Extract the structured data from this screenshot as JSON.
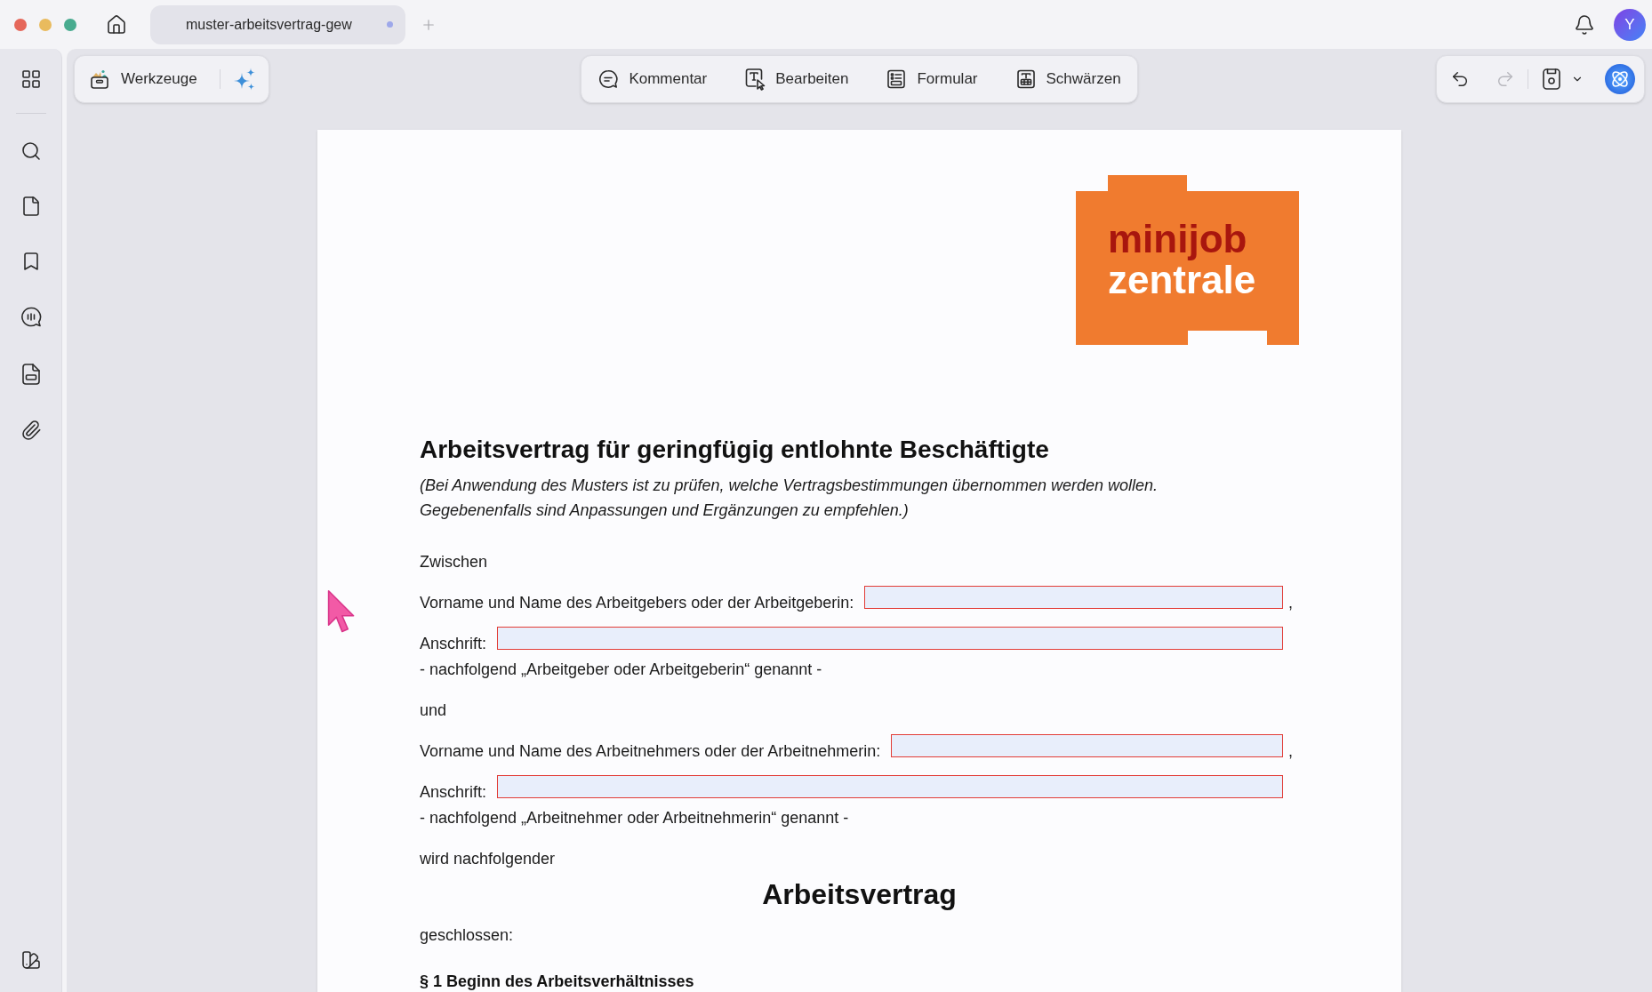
{
  "tabs": [
    {
      "label": "muster-arbeitsvertrag-gew",
      "selected": true
    }
  ],
  "user": {
    "initial": "Y"
  },
  "toolbar": {
    "tools_button": {
      "label": "Werkzeuge"
    },
    "modes": [
      {
        "kind": "comment",
        "label": "Kommentar"
      },
      {
        "kind": "edit",
        "label": "Bearbeiten"
      },
      {
        "kind": "form",
        "label": "Formular"
      },
      {
        "kind": "redact",
        "label": "Schwärzen"
      }
    ],
    "history": [
      {
        "kind": "undo",
        "disabled": false
      },
      {
        "kind": "redo",
        "disabled": true
      }
    ]
  },
  "document": {
    "logo": {
      "lines": [
        "minijob",
        "zentrale"
      ]
    },
    "title": "Arbeitsvertrag für geringfügig entlohnte Beschäftigte",
    "subtitle": "(Bei Anwendung des Musters ist zu prüfen, welche Vertragsbestimmungen übernommen werden wollen. Gegebenenfalls sind Anpassungen und Ergänzungen zu empfehlen.)",
    "blocks": [
      {
        "kind": "paragraph",
        "text": "Zwischen"
      },
      {
        "kind": "field_row",
        "label": "Vorname und Name des Arbeitgebers oder der Arbeitgeberin:",
        "suffix": ","
      },
      {
        "kind": "field_row",
        "label": "Anschrift:"
      },
      {
        "kind": "note",
        "text": "- nachfolgend „Arbeitgeber oder Arbeitgeberin“ genannt -"
      },
      {
        "kind": "paragraph",
        "text": "und"
      },
      {
        "kind": "field_row",
        "label": "Vorname und Name des Arbeitnehmers oder der Arbeitnehmerin:",
        "suffix": ","
      },
      {
        "kind": "field_row",
        "label": "Anschrift:"
      },
      {
        "kind": "note",
        "text": "- nachfolgend „Arbeitnehmer oder Arbeitnehmerin“ genannt -"
      },
      {
        "kind": "paragraph",
        "text": "wird nachfolgender"
      },
      {
        "kind": "heading",
        "text": "Arbeitsvertrag"
      },
      {
        "kind": "paragraph",
        "text": "geschlossen:"
      },
      {
        "kind": "section_heading",
        "text": "§ 1 Beginn des Arbeitsverhältnisses"
      }
    ]
  }
}
